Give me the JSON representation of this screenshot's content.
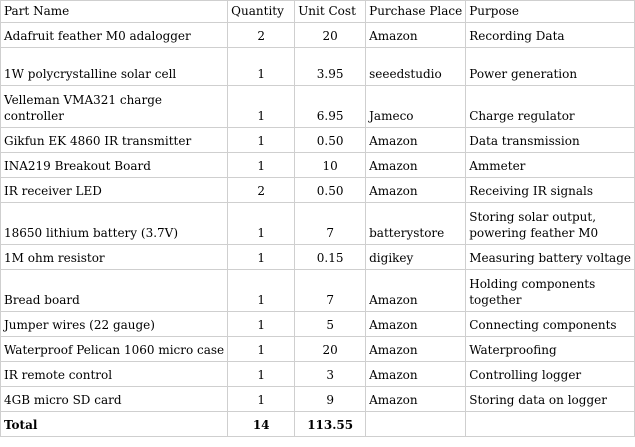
{
  "table": {
    "headers": [
      "Part Name",
      "Quantity",
      "Unit Cost",
      "Purchase Place",
      "Purpose"
    ],
    "rows": [
      [
        "Adafruit feather M0 adalogger",
        "2",
        "20",
        "Amazon",
        "Recording Data"
      ],
      [
        "1W polycrystalline solar cell",
        "1",
        "3.95",
        "seeedstudio",
        "Power generation"
      ],
      [
        "Velleman VMA321  charge controller",
        "1",
        "6.95",
        "Jameco",
        "Charge regulator"
      ],
      [
        "Gikfun EK 4860 IR transmitter",
        "1",
        "0.50",
        "Amazon",
        "Data transmission"
      ],
      [
        "INA219 Breakout Board",
        "1",
        "10",
        "Amazon",
        "Ammeter"
      ],
      [
        "IR receiver LED",
        "2",
        "0.50",
        "Amazon",
        "Receiving IR signals"
      ],
      [
        "18650 lithium battery (3.7V)",
        "1",
        "7",
        "batterystore",
        "Storing solar output, powering feather M0"
      ],
      [
        "1M ohm resistor",
        "1",
        "0.15",
        "digikey",
        "Measuring battery voltage"
      ],
      [
        "Bread board",
        "1",
        "7",
        "Amazon",
        "Holding components together"
      ],
      [
        "Jumper wires (22 gauge)",
        "1",
        "5",
        "Amazon",
        "Connecting components"
      ],
      [
        "Waterproof Pelican 1060 micro case",
        "1",
        "20",
        "Amazon",
        "Waterproofing"
      ],
      [
        "IR remote control",
        "1",
        "3",
        "Amazon",
        "Controlling logger"
      ],
      [
        "4GB micro SD card",
        "1",
        "9",
        "Amazon",
        "Storing data on logger"
      ]
    ],
    "total": {
      "label": "Total",
      "quantity": "14",
      "unit_cost": "113.55",
      "purchase_place": "",
      "purpose": ""
    }
  }
}
